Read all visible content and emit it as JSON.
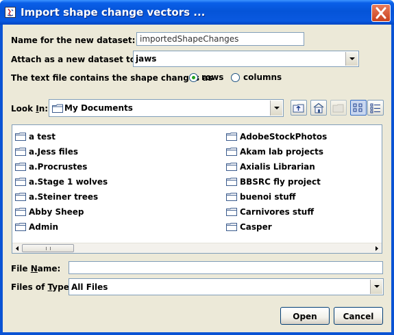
{
  "window": {
    "title": "Import shape change vectors ..."
  },
  "form": {
    "name_label": "Name for the new dataset:",
    "name_value": "importedShapeChanges",
    "attach_label": "Attach as a new dataset to:",
    "attach_value": "jaws",
    "contains_label": "The text file contains the shape changes as",
    "radio_rows": "rows",
    "radio_columns": "columns",
    "selected": "rows"
  },
  "chooser": {
    "look_in_label_pre": "Look ",
    "look_in_label_mn": "I",
    "look_in_label_post": "n:",
    "look_in_value": "My Documents",
    "toolbar_icons": [
      "up-one-level-icon",
      "home-icon",
      "new-folder-icon",
      "list-view-icon",
      "details-view-icon"
    ],
    "files_col1": [
      "a test",
      "a.Jess files",
      "a.Procrustes",
      "a.Stage 1 wolves",
      "a.Steiner trees",
      "Abby Sheep",
      "Admin"
    ],
    "files_col2": [
      "AdobeStockPhotos",
      "Akam lab projects",
      "Axialis Librarian",
      "BBSRC fly project",
      "buenoi stuff",
      "Carnivores stuff",
      "Casper"
    ],
    "file_name_pre": "File ",
    "file_name_mn": "N",
    "file_name_post": "ame:",
    "file_name_value": "",
    "file_type_pre": "Files of ",
    "file_type_mn": "T",
    "file_type_post": "ype:",
    "file_type_value": "All Files"
  },
  "buttons": {
    "open": "Open",
    "cancel": "Cancel"
  },
  "colors": {
    "title_bar": "#0a5fe8",
    "dialog_bg": "#ece9d8",
    "field_border": "#7f9db9",
    "close_red": "#c9421d"
  }
}
